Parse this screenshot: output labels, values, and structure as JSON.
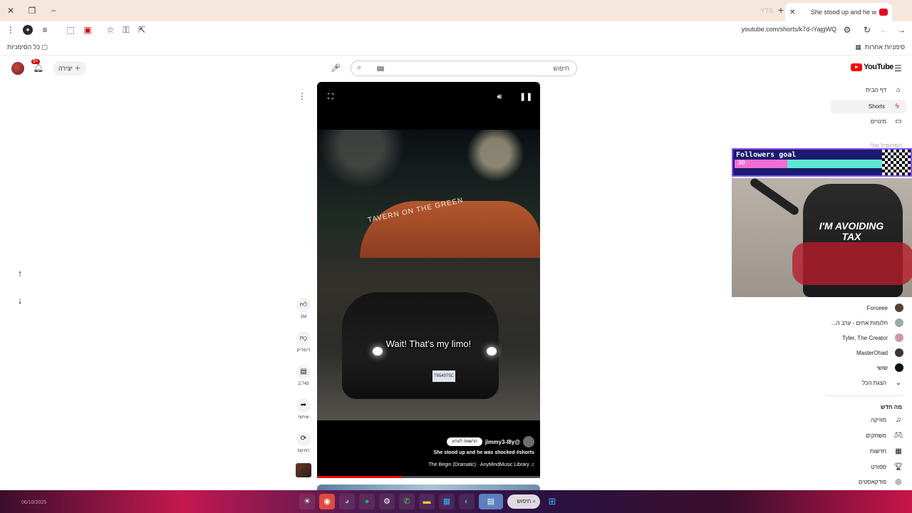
{
  "browser": {
    "tab_title": "She stood up and he w",
    "url": "youtube.com/shorts/k7d-iYajgWQ",
    "bookmarks_left": "כל הסימניות",
    "bookmarks_right": "סימניות אחרות"
  },
  "header": {
    "notification_count": "9+",
    "create_label": "יצירה",
    "search_placeholder": "חיפוש",
    "logo_text": "YouTube"
  },
  "player": {
    "caption": "Wait! That's my limo!",
    "awning_text": "TAVERN ON THE GREEN",
    "plate": "T654075C",
    "channel_name": "@jimmy3-l8y",
    "subscribe_label": "הרשמה לערוץ",
    "title": "She stood up and he was shocked #shorts",
    "music": "The Begin (Dramatic) · AnyMindMusic Library",
    "progress": 0.38
  },
  "actions": {
    "likes": "1M",
    "dislike_label": "דיסלייק",
    "comments": "2,743",
    "share_label": "שיתוף",
    "remix_label": "רמיקס"
  },
  "sidebar": {
    "items": [
      {
        "label": "דף הבית",
        "icon": "home-icon"
      },
      {
        "label": "Shorts",
        "icon": "shorts-icon"
      },
      {
        "label": "מינויים",
        "icon": "subscriptions-icon"
      }
    ],
    "you_label": "הפרופיל שלי",
    "subscriptions": [
      {
        "name": "Forceee"
      },
      {
        "name": "חלומות אחים - ערב ה..."
      },
      {
        "name": "Tyler, The Creator"
      },
      {
        "name": "MasterOhad"
      },
      {
        "name": "שושי"
      }
    ],
    "show_more": "הצגת הכל",
    "explore_header": "מה חדש",
    "explore": [
      {
        "label": "מוזיקה",
        "icon": "music-icon"
      },
      {
        "label": "משחקים",
        "icon": "gaming-icon"
      },
      {
        "label": "חדשות",
        "icon": "news-icon"
      },
      {
        "label": "ספורט",
        "icon": "trophy-icon"
      },
      {
        "label": "פודקאסטים",
        "icon": "podcast-icon"
      }
    ]
  },
  "overlay": {
    "goal_title": "Followers goal",
    "goal_current": "30",
    "goal_max": "100",
    "goal_fraction": 0.3,
    "chair_text": "I'M AVOIDING TAX"
  },
  "taskbar": {
    "search_label": "חיפוש",
    "date": "06/10/2025"
  }
}
